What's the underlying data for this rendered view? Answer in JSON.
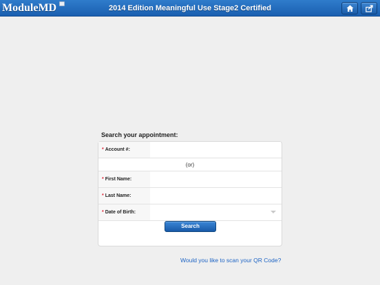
{
  "header": {
    "logo_text_a": "Module",
    "logo_text_b": "MD",
    "title": "2014 Edition Meaningful Use Stage2 Certified",
    "home_icon": "home-icon",
    "share_icon": "share-icon"
  },
  "form": {
    "heading": "Search your appointment:",
    "required_mark": "*",
    "account_label": "Account #:",
    "account_value": "",
    "or_text": "(or)",
    "first_name_label": "First Name:",
    "first_name_value": "",
    "last_name_label": "Last Name:",
    "last_name_value": "",
    "dob_label": "Date of Birth:",
    "dob_value": "",
    "search_label": "Search"
  },
  "qr_link": "Would you like to scan your QR Code?",
  "colors": {
    "header_blue": "#1a5fb0",
    "link_blue": "#1c63c4",
    "required_red": "#dd2233"
  }
}
